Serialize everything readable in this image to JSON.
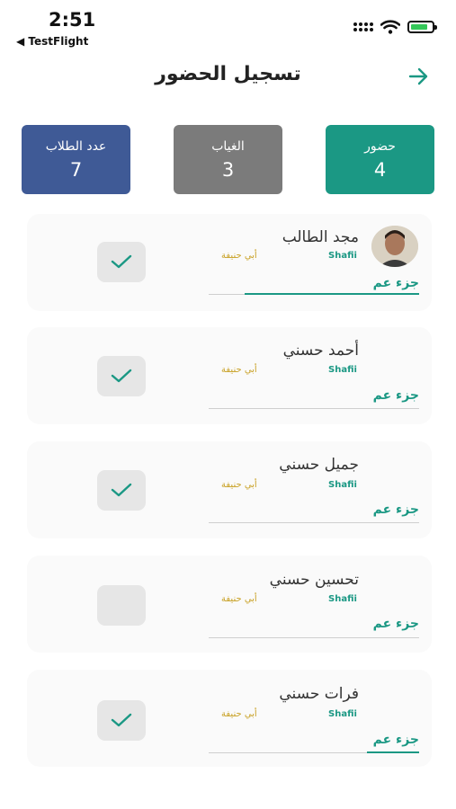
{
  "status_bar": {
    "time": "2:51",
    "back_app": "◀ TestFlight"
  },
  "header": {
    "title": "تسجيل الحضور",
    "back_icon": "arrow-right-icon"
  },
  "stats": {
    "students_label": "عدد الطلاب",
    "students_value": "7",
    "absent_label": "الغياب",
    "absent_value": "3",
    "present_label": "حضور",
    "present_value": "4",
    "colors": {
      "students": "#3f5a96",
      "absent": "#7b7b7b",
      "present": "#1b9884"
    }
  },
  "students": [
    {
      "name": "مجد الطالب",
      "madhhab_tag": "Shafii",
      "school_tag": "أبي حنيفة",
      "juz": "جزء عم",
      "checked": true,
      "has_avatar": true
    },
    {
      "name": "أحمد حسني",
      "madhhab_tag": "Shafii",
      "school_tag": "أبي حنيفة",
      "juz": "جزء عم",
      "checked": true,
      "has_avatar": false
    },
    {
      "name": "جميل حسني",
      "madhhab_tag": "Shafii",
      "school_tag": "أبي حنيفة",
      "juz": "جزء عم",
      "checked": true,
      "has_avatar": false
    },
    {
      "name": "تحسين حسني",
      "madhhab_tag": "Shafii",
      "school_tag": "أبي حنيفة",
      "juz": "جزء عم",
      "checked": false,
      "has_avatar": false
    },
    {
      "name": "فرات حسني",
      "madhhab_tag": "Shafii",
      "school_tag": "أبي حنيفة",
      "juz": "جزء عم",
      "checked": true,
      "has_avatar": false
    }
  ]
}
